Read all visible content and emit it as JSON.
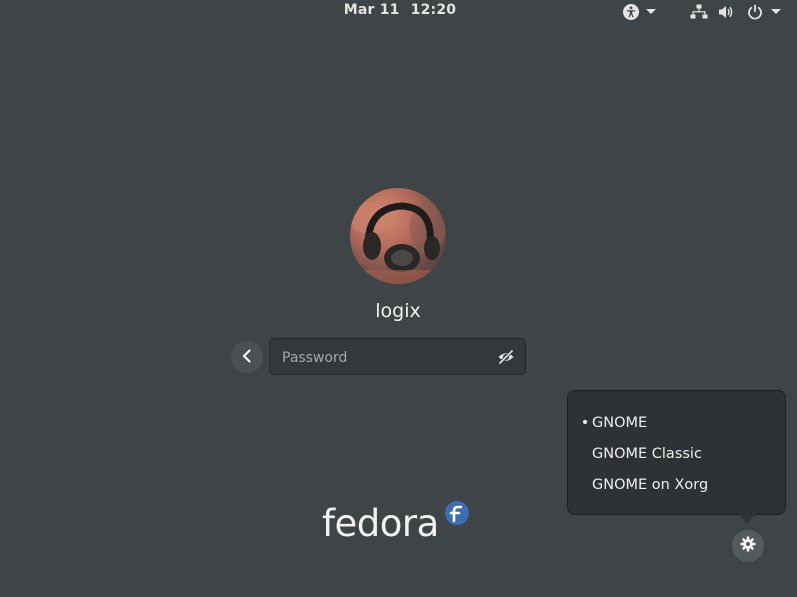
{
  "topbar": {
    "date": "Mar 11",
    "time": "12:20",
    "accessibility_icon": "accessibility-icon",
    "network_icon": "network-wired-icon",
    "volume_icon": "volume-icon",
    "power_icon": "power-icon"
  },
  "user": {
    "avatar_icon": "user-avatar-headphones",
    "name": "logix"
  },
  "login": {
    "back_icon": "chevron-left-icon",
    "password_placeholder": "Password",
    "password_value": "",
    "reveal_icon": "eye-slash-icon"
  },
  "session_menu": {
    "items": [
      {
        "label": "GNOME",
        "selected": true,
        "bullet": "•"
      },
      {
        "label": "GNOME Classic",
        "selected": false,
        "bullet": ""
      },
      {
        "label": "GNOME on Xorg",
        "selected": false,
        "bullet": ""
      }
    ]
  },
  "session_button": {
    "icon": "gear-icon"
  },
  "branding": {
    "logo_text": "fedora",
    "logo_mark": "fedora-infinity-f-icon"
  },
  "colors": {
    "background": "#3f4446",
    "popover": "#2e3234",
    "fedora_blue": "#3c6eb4"
  }
}
